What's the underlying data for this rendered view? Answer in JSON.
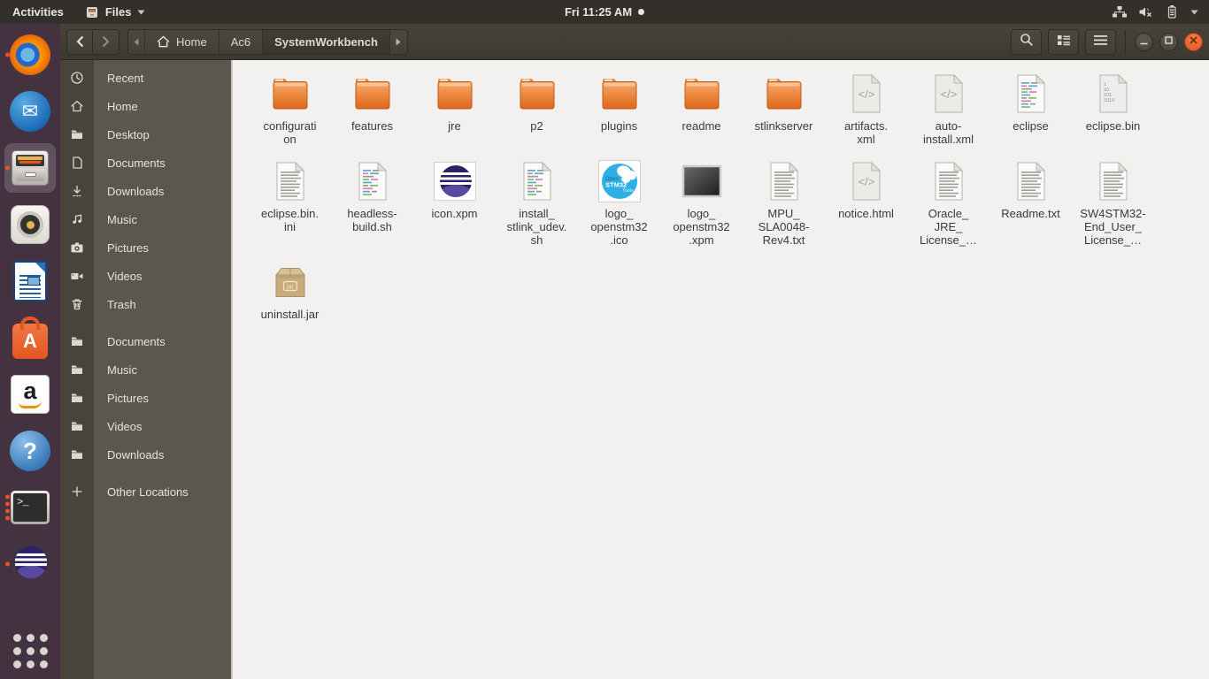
{
  "topbar": {
    "activities_label": "Activities",
    "app_menu": {
      "label": "Files",
      "icon": "files-app-icon",
      "caret_icon": "chevron-down-icon"
    },
    "clock": "Fri 11:25 AM",
    "indicator_icons": [
      "network-icon",
      "volume-muted-icon",
      "battery-icon",
      "chevron-down-icon"
    ]
  },
  "dock": {
    "items": [
      {
        "icon": "firefox-icon",
        "running_dots": 1,
        "active": false
      },
      {
        "icon": "thunderbird-icon",
        "running_dots": 0,
        "active": false
      },
      {
        "icon": "files-icon",
        "running_dots": 1,
        "active": true
      },
      {
        "icon": "rhythmbox-icon",
        "running_dots": 0,
        "active": false
      },
      {
        "icon": "libreoffice-writer-icon",
        "running_dots": 0,
        "active": false
      },
      {
        "icon": "ubuntu-software-icon",
        "running_dots": 0,
        "active": false
      },
      {
        "icon": "amazon-icon",
        "running_dots": 0,
        "active": false
      },
      {
        "icon": "help-icon",
        "running_dots": 0,
        "active": false
      },
      {
        "icon": "terminal-icon",
        "running_dots": 4,
        "active": false
      },
      {
        "icon": "eclipse-icon",
        "running_dots": 1,
        "active": false
      }
    ]
  },
  "headerbar": {
    "path": [
      {
        "label": "Home",
        "icon": "home-icon",
        "current": false
      },
      {
        "label": "Ac6",
        "current": false
      },
      {
        "label": "SystemWorkbench",
        "current": true
      }
    ]
  },
  "sidebar": {
    "places": [
      {
        "label": "Recent",
        "icon": "clock-icon"
      },
      {
        "label": "Home",
        "icon": "home-icon"
      },
      {
        "label": "Desktop",
        "icon": "folder-icon"
      },
      {
        "label": "Documents",
        "icon": "document-icon"
      },
      {
        "label": "Downloads",
        "icon": "download-icon"
      },
      {
        "label": "Music",
        "icon": "music-icon"
      },
      {
        "label": "Pictures",
        "icon": "camera-icon"
      },
      {
        "label": "Videos",
        "icon": "video-icon"
      },
      {
        "label": "Trash",
        "icon": "trash-icon"
      }
    ],
    "bookmarks": [
      {
        "label": "Documents",
        "icon": "folder-icon"
      },
      {
        "label": "Music",
        "icon": "folder-icon"
      },
      {
        "label": "Pictures",
        "icon": "folder-icon"
      },
      {
        "label": "Videos",
        "icon": "folder-icon"
      },
      {
        "label": "Downloads",
        "icon": "folder-icon"
      }
    ],
    "other_locations": {
      "label": "Other Locations",
      "icon": "plus-icon"
    }
  },
  "files": [
    {
      "label": "configurati\non",
      "type": "folder"
    },
    {
      "label": "features",
      "type": "folder"
    },
    {
      "label": "jre",
      "type": "folder"
    },
    {
      "label": "p2",
      "type": "folder"
    },
    {
      "label": "plugins",
      "type": "folder"
    },
    {
      "label": "readme",
      "type": "folder"
    },
    {
      "label": "stlinkserver",
      "type": "folder"
    },
    {
      "label": "artifacts.\nxml",
      "type": "markup"
    },
    {
      "label": "auto-\ninstall.xml",
      "type": "markup"
    },
    {
      "label": "eclipse",
      "type": "script"
    },
    {
      "label": "eclipse.bin",
      "type": "binary",
      "icon_text": "1\n10\n101\n1010"
    },
    {
      "label": "eclipse.bin.\nini",
      "type": "text"
    },
    {
      "label": "headless-\nbuild.sh",
      "type": "script"
    },
    {
      "label": "icon.xpm",
      "type": "image-eclipse"
    },
    {
      "label": "install_\nstlink_udev.\nsh",
      "type": "script"
    },
    {
      "label": "logo_\nopenstm32\n.ico",
      "type": "image-openstm32",
      "icon_text": "Open\nSTM32\nTools"
    },
    {
      "label": "logo_\nopenstm32\n.xpm",
      "type": "image-dark"
    },
    {
      "label": "MPU_\nSLA0048-\nRev4.txt",
      "type": "text"
    },
    {
      "label": "notice.html",
      "type": "markup"
    },
    {
      "label": "Oracle_\nJRE_\nLicense_…",
      "type": "text"
    },
    {
      "label": "Readme.txt",
      "type": "text"
    },
    {
      "label": "SW4STM32-\nEnd_User_\nLicense_…",
      "type": "text"
    },
    {
      "label": "uninstall.jar",
      "type": "archive-jar",
      "icon_text": "jar"
    }
  ],
  "colors": {
    "accent_orange": "#e95420",
    "close_button": "#e2542b",
    "topbar_bg": "#332f2b",
    "dock_bg": "#453241",
    "headerbar_bg": "#413e37",
    "sidebar_bg": "#5c574d",
    "sidebar_gutter_bg": "#48433b",
    "content_bg": "#f2f1ef",
    "folder_orange": "#e8751f"
  }
}
